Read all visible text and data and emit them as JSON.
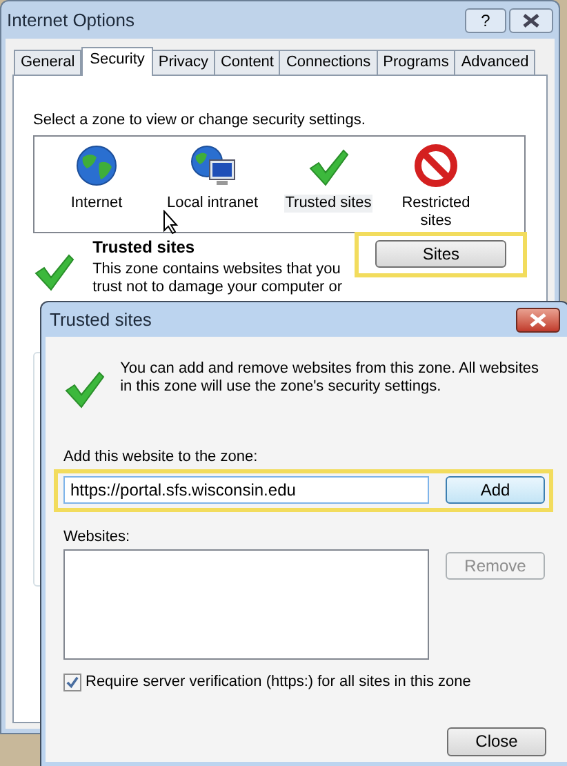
{
  "main_window": {
    "title": "Internet Options",
    "help_button": "?",
    "tabs": [
      {
        "label": "General",
        "selected": false
      },
      {
        "label": "Security",
        "selected": true
      },
      {
        "label": "Privacy",
        "selected": false
      },
      {
        "label": "Content",
        "selected": false
      },
      {
        "label": "Connections",
        "selected": false
      },
      {
        "label": "Programs",
        "selected": false
      },
      {
        "label": "Advanced",
        "selected": false
      }
    ],
    "zone_prompt": "Select a zone to view or change security settings.",
    "zones": [
      {
        "kind": "internet",
        "label": "Internet",
        "selected": false
      },
      {
        "kind": "intranet",
        "label": "Local intranet",
        "selected": false
      },
      {
        "kind": "trusted",
        "label": "Trusted sites",
        "selected": true
      },
      {
        "kind": "restricted",
        "label": "Restricted sites",
        "selected": false
      }
    ],
    "zone_title": "Trusted sites",
    "zone_description": "This zone contains websites that you trust not to damage your computer or",
    "sites_button": "Sites"
  },
  "dialog": {
    "title": "Trusted sites",
    "message": "You can add and remove websites from this zone. All websites in this zone will use the zone's security settings.",
    "add_label": "Add this website to the zone:",
    "url_value": "https://portal.sfs.wisconsin.edu",
    "add_button": "Add",
    "websites_label": "Websites:",
    "remove_button": {
      "label": "Remove",
      "disabled": true
    },
    "require_verification": {
      "label": "Require server verification (https:) for all sites in this zone",
      "checked": true
    },
    "close_button": "Close"
  }
}
